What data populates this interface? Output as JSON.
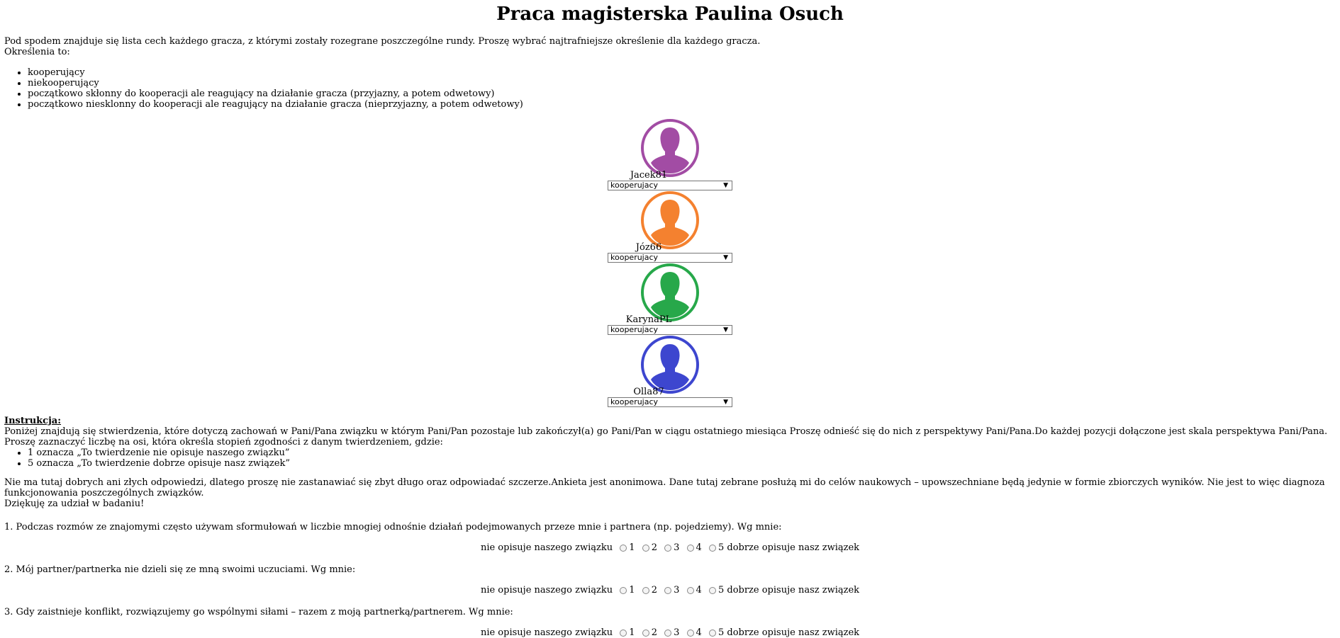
{
  "title": "Praca magisterska Paulina Osuch",
  "intro": {
    "line1": "Pod spodem znajduje się lista cech każdego gracza, z którymi zostały rozegrane poszczególne rundy. Proszę wybrać najtrafniejsze określenie dla każdego gracza.",
    "line2": "Określenia to:",
    "options": [
      "kooperujący",
      "niekooperujący",
      "początkowo skłonny do kooperacji ale reagujący na działanie gracza (przyjazny, a potem odwetowy)",
      "początkowo niesklonny do kooperacji ale reagujący na działanie gracza (nieprzyjazny, a potem odwetowy)"
    ]
  },
  "players": [
    {
      "name": "Jacek81",
      "selected": "kooperujacy",
      "color": "#a24ca4",
      "icon": "person-avatar-icon"
    },
    {
      "name": "Józ66",
      "selected": "kooperujacy",
      "color": "#f4812f",
      "icon": "person-avatar-icon"
    },
    {
      "name": "KarynaPL",
      "selected": "kooperujacy",
      "color": "#27a84a",
      "icon": "person-avatar-icon"
    },
    {
      "name": "Olla87",
      "selected": "kooperujacy",
      "color": "#3d46cf",
      "icon": "person-avatar-icon"
    }
  ],
  "instruction": {
    "heading": "Instrukcja:",
    "text": "Poniżej znajdują się stwierdzenia, które dotyczą zachowań w Pani/Pana związku w którym Pani/Pan pozostaje lub zakończył(a) go Pani/Pan w ciągu ostatniego miesiąca Proszę odnieść się do nich z perspektywy Pani/Pana.Do każdej pozycji dołączone jest skala perspektywa Pani/Pana. Proszę zaznaczyć liczbę na osi, która określa stopień zgodności z danym twierdzeniem, gdzie:",
    "scale_items": [
      "1 oznacza „To twierdzenie nie opisuje naszego związku”",
      "5 oznacza „To twierdzenie dobrze opisuje nasz związek”"
    ],
    "note1": "Nie ma tutaj dobrych ani złych odpowiedzi, dlatego proszę nie zastanawiać się zbyt długo oraz odpowiadać szczerze.Ankieta jest anonimowa. Dane tutaj zebrane posłużą mi do celów naukowych – upowszechniane będą jedynie w formie zbiorczych wyników. Nie jest to więc diagnoza funkcjonowania poszczególnych związków.",
    "note2": "Dziękuję za udział w badaniu!"
  },
  "scale": {
    "left_label": "nie opisuje naszego związku",
    "right_label": "dobrze opisuje nasz związek",
    "values": [
      "1",
      "2",
      "3",
      "4",
      "5"
    ]
  },
  "questions": [
    "1. Podczas rozmów ze znajomymi często używam sformułowań w liczbie mnogiej odnośnie działań podejmowanych przeze mnie i partnera (np. pojedziemy). Wg mnie:",
    "2. Mój partner/partnerka nie dzieli się ze mną swoimi uczuciami. Wg mnie:",
    "3. Gdy zaistnieje konflikt, rozwiązujemy go wspólnymi siłami – razem z moją partnerką/partnerem. Wg mnie:"
  ]
}
